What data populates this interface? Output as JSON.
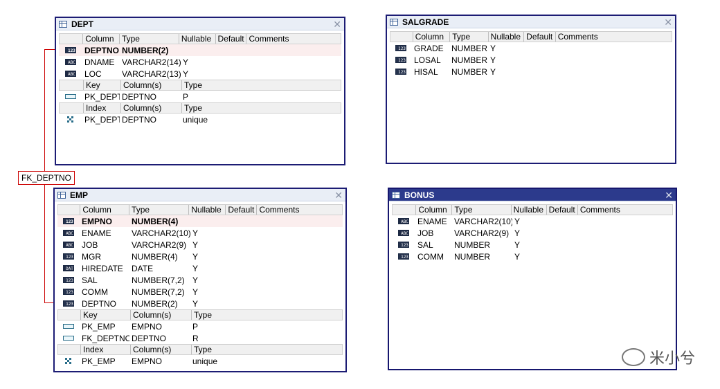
{
  "relationship": {
    "label": "FK_DEPTNO"
  },
  "watermark": {
    "text": "米小兮"
  },
  "windows": {
    "dept": {
      "title": "DEPT",
      "columns_header": [
        "Column",
        "Type",
        "Nullable",
        "Default",
        "Comments"
      ],
      "columns": [
        {
          "icon": "number-icon",
          "name": "DEPTNO",
          "type": "NUMBER(2)",
          "nullable": "",
          "pk": true
        },
        {
          "icon": "text-icon",
          "name": "DNAME",
          "type": "VARCHAR2(14)",
          "nullable": "Y"
        },
        {
          "icon": "text-icon",
          "name": "LOC",
          "type": "VARCHAR2(13)",
          "nullable": "Y"
        }
      ],
      "keys_header": [
        "Key",
        "Column(s)",
        "Type"
      ],
      "keys": [
        {
          "name": "PK_DEPT",
          "columns": "DEPTNO",
          "type": "P"
        }
      ],
      "index_header": [
        "Index",
        "Column(s)",
        "Type"
      ],
      "indexes": [
        {
          "name": "PK_DEPT",
          "columns": "DEPTNO",
          "type": "unique"
        }
      ]
    },
    "salgrade": {
      "title": "SALGRADE",
      "columns_header": [
        "Column",
        "Type",
        "Nullable",
        "Default",
        "Comments"
      ],
      "columns": [
        {
          "icon": "number-icon",
          "name": "GRADE",
          "type": "NUMBER",
          "nullable": "Y"
        },
        {
          "icon": "number-icon",
          "name": "LOSAL",
          "type": "NUMBER",
          "nullable": "Y"
        },
        {
          "icon": "number-icon",
          "name": "HISAL",
          "type": "NUMBER",
          "nullable": "Y"
        }
      ]
    },
    "emp": {
      "title": "EMP",
      "columns_header": [
        "Column",
        "Type",
        "Nullable",
        "Default",
        "Comments"
      ],
      "columns": [
        {
          "icon": "number-icon",
          "name": "EMPNO",
          "type": "NUMBER(4)",
          "nullable": "",
          "pk": true
        },
        {
          "icon": "text-icon",
          "name": "ENAME",
          "type": "VARCHAR2(10)",
          "nullable": "Y"
        },
        {
          "icon": "text-icon",
          "name": "JOB",
          "type": "VARCHAR2(9)",
          "nullable": "Y"
        },
        {
          "icon": "number-icon",
          "name": "MGR",
          "type": "NUMBER(4)",
          "nullable": "Y"
        },
        {
          "icon": "date-icon",
          "name": "HIREDATE",
          "type": "DATE",
          "nullable": "Y"
        },
        {
          "icon": "number-icon",
          "name": "SAL",
          "type": "NUMBER(7,2)",
          "nullable": "Y"
        },
        {
          "icon": "number-icon",
          "name": "COMM",
          "type": "NUMBER(7,2)",
          "nullable": "Y"
        },
        {
          "icon": "number-icon",
          "name": "DEPTNO",
          "type": "NUMBER(2)",
          "nullable": "Y"
        }
      ],
      "keys_header": [
        "Key",
        "Column(s)",
        "Type"
      ],
      "keys": [
        {
          "name": "PK_EMP",
          "columns": "EMPNO",
          "type": "P"
        },
        {
          "name": "FK_DEPTNO",
          "columns": "DEPTNO",
          "type": "R"
        }
      ],
      "index_header": [
        "Index",
        "Column(s)",
        "Type"
      ],
      "indexes": [
        {
          "name": "PK_EMP",
          "columns": "EMPNO",
          "type": "unique"
        }
      ]
    },
    "bonus": {
      "title": "BONUS",
      "columns_header": [
        "Column",
        "Type",
        "Nullable",
        "Default",
        "Comments"
      ],
      "columns": [
        {
          "icon": "text-icon",
          "name": "ENAME",
          "type": "VARCHAR2(10)",
          "nullable": "Y"
        },
        {
          "icon": "text-icon",
          "name": "JOB",
          "type": "VARCHAR2(9)",
          "nullable": "Y"
        },
        {
          "icon": "number-icon",
          "name": "SAL",
          "type": "NUMBER",
          "nullable": "Y"
        },
        {
          "icon": "number-icon",
          "name": "COMM",
          "type": "NUMBER",
          "nullable": "Y"
        }
      ]
    }
  },
  "icon_text": {
    "number-icon": "123",
    "text-icon": "ABC",
    "date-icon": "DAT"
  }
}
